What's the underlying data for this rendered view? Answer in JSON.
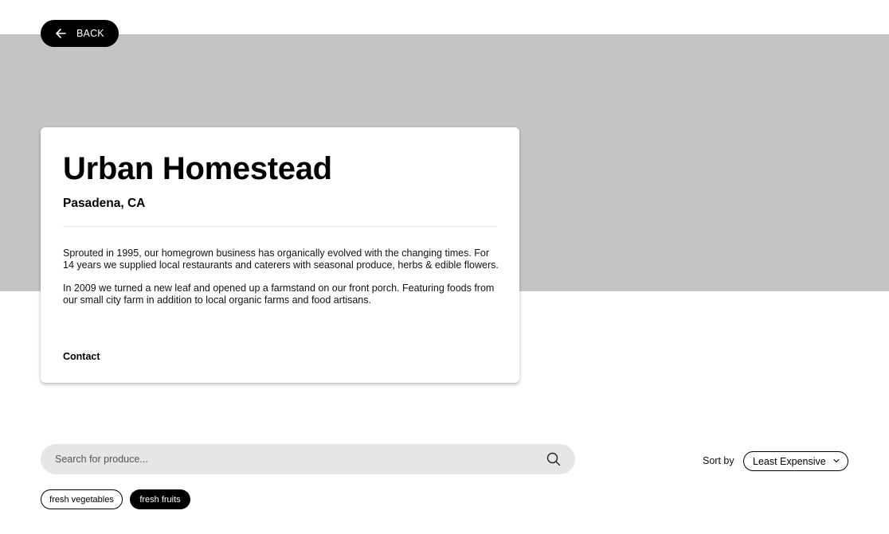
{
  "header": {
    "back_label": "BACK"
  },
  "profile": {
    "name": "Urban Homestead",
    "location": "Pasadena, CA",
    "paragraphs": [
      "Sprouted in 1995, our homegrown business has organically evolved with the changing times. For 14 years we supplied local restaurants and caterers with seasonal produce, herbs & edible flowers.",
      "In 2009 we turned a new leaf and opened up a farmstand on our front porch. Featuring foods from our small city farm in addition to local organic farms and food artisans."
    ],
    "contact_label": "Contact"
  },
  "search": {
    "placeholder": "Search for produce...",
    "value": ""
  },
  "sort": {
    "label": "Sort by",
    "selected": "Least Expensive"
  },
  "filters": [
    {
      "label": "fresh vegetables",
      "active": false
    },
    {
      "label": "fresh fruits",
      "active": true
    }
  ],
  "colors": {
    "hero_background": "#c4c4c4",
    "search_background": "#e6e6e6",
    "accent": "#000000"
  },
  "icons": {
    "back": "arrow-left-icon",
    "search": "search-icon",
    "sort_dropdown": "chevron-down-icon"
  }
}
